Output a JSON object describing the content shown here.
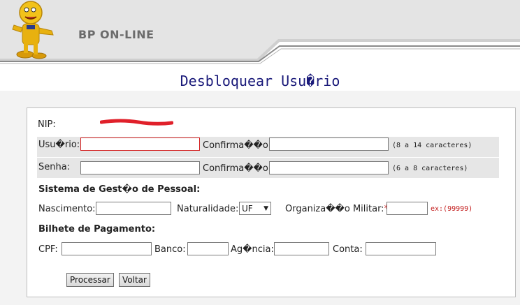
{
  "header": {
    "app_title": "BP ON-LINE"
  },
  "page": {
    "title": "Desbloquear Usu�rio"
  },
  "form": {
    "nip_label": "NIP:",
    "usuario_label": "Usu�rio:",
    "confirmacao_label": "Confirma��o:",
    "usuario_hint": "(8 a 14 caracteres)",
    "senha_label": "Senha:",
    "senha_hint": "(6 a 8 caracteres)",
    "section_pessoal": "Sistema de Gest�o de Pessoal:",
    "nascimento_label": "Nascimento:",
    "naturalidade_label": "Naturalidade:",
    "naturalidade_value": "UF",
    "org_militar_label": "Organiza��o Militar:",
    "required_mark": "*",
    "org_militar_hint": "ex:(99999)",
    "section_bilhete": "Bilhete de Pagamento:",
    "cpf_label": "CPF:",
    "banco_label": "Banco:",
    "agencia_label": "Ag�ncia:",
    "conta_label": "Conta:"
  },
  "buttons": {
    "processar": "Processar",
    "voltar": "Voltar"
  },
  "colors": {
    "title": "#1a1a7a",
    "header_text": "#6b6b6b",
    "required": "#d32020",
    "header_band": "#c8c8c8"
  }
}
